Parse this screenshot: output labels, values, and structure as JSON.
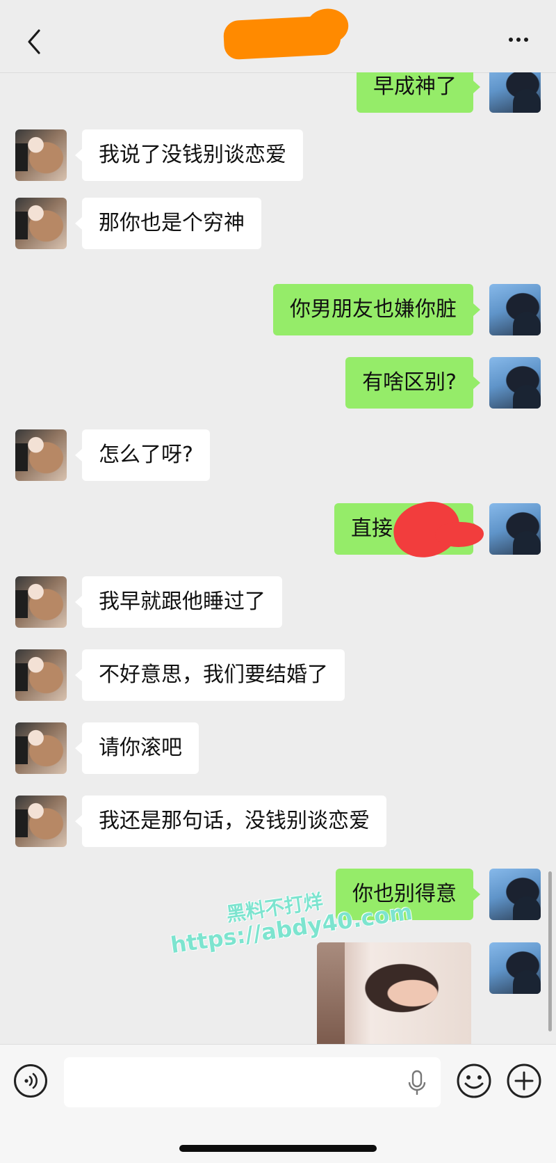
{
  "header": {
    "title": "",
    "back_icon": "chevron-left-icon",
    "more_icon": "more-dots-icon",
    "title_redaction_color": "#ff8a00"
  },
  "messages": [
    {
      "side": "out",
      "text": "早成神了"
    },
    {
      "side": "in",
      "text": "我说了没钱别谈恋爱"
    },
    {
      "side": "in",
      "text": "那你也是个穷神"
    },
    {
      "side": "out",
      "text": "你男朋友也嫌你脏"
    },
    {
      "side": "out",
      "text": "有啥区别?"
    },
    {
      "side": "in",
      "text": "怎么了呀?"
    },
    {
      "side": "out",
      "text": "直接"
    },
    {
      "side": "in",
      "text": "我早就跟他睡过了"
    },
    {
      "side": "in",
      "text": "不好意思，我们要结婚了"
    },
    {
      "side": "in",
      "text": "请你滚吧"
    },
    {
      "side": "in",
      "text": "我还是那句话，没钱别谈恋爱"
    },
    {
      "side": "out",
      "text": "你也别得意"
    },
    {
      "side": "out",
      "type": "image"
    }
  ],
  "watermark": {
    "line1": "黑料不打烊",
    "line2": "https://abdy40.com"
  },
  "input_bar": {
    "voice_icon": "voice-icon",
    "mic_icon": "microphone-icon",
    "emoji_icon": "emoji-icon",
    "plus_icon": "plus-icon",
    "placeholder": ""
  },
  "colors": {
    "outgoing_bubble": "#95ec69",
    "incoming_bubble": "#ffffff",
    "background": "#ededed",
    "redaction_red": "#f23d3d"
  }
}
